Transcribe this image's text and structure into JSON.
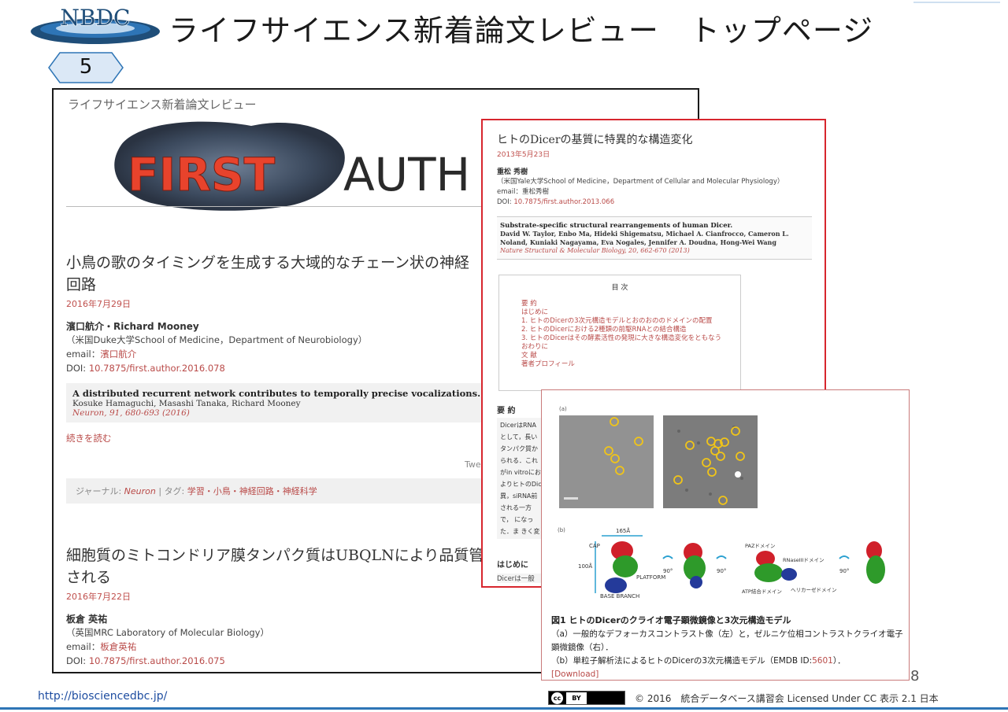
{
  "header": {
    "logo_text": "NBDC",
    "title": "ライフサイエンス新着論文レビュー　トップページ",
    "slide_number": "5"
  },
  "screenshot": {
    "site_name": "ライフサイエンス新着論文レビュー",
    "banner_text_red": "FIRST",
    "banner_text_dark": "AUTH",
    "articles": [
      {
        "title": "小鳥の歌のタイミングを生成する大域的なチェーン状の神経\n回路",
        "date": "2016年7月29日",
        "author": "濱口航介・Richard Mooney",
        "affiliation": "（米国Duke大学School of Medicine，Department of Neurobiology）",
        "email_label": "email：",
        "email_value": "濱口航介",
        "doi_label": "DOI: ",
        "doi_value": "10.7875/first.author.2016.078",
        "ref_title": "A distributed recurrent network contributes to temporally precise vocalizations.",
        "ref_authors": "Kosuke Hamaguchi, Masashi Tanaka, Richard Mooney",
        "ref_journal": "Neuron, 91, 680-693 (2016)",
        "read_more": "続きを読む"
      },
      {
        "title": "細胞質のミトコンドリア膜タンパク質はUBQLNにより品質管理\nされる",
        "date": "2016年7月22日",
        "author": "板倉 英祐",
        "affiliation": "（英国MRC Laboratory of Molecular Biology）",
        "email_label": "email：",
        "email_value": "板倉英祐",
        "doi_label": "DOI: ",
        "doi_value": "10.7875/first.author.2016.075"
      }
    ],
    "tweet_label": "Twe",
    "tag_bar": {
      "journal_label": "ジャーナル: ",
      "journal_value": "Neuron",
      "sep": " | ",
      "tag_label": "タグ: ",
      "tag_value": "学習・小鳥・神経回路・神経科学"
    }
  },
  "overlay_article": {
    "title": "ヒトのDicerの基質に特異的な構造変化",
    "date": "2013年5月23日",
    "author": "重松 秀樹",
    "affiliation": "（米国Yale大学School of Medicine，Department of Cellular and Molecular Physiology）",
    "email": "email：重松秀樹",
    "doi_label": "DOI: ",
    "doi_value": "10.7875/first.author.2013.066",
    "ref_title": "Substrate-specific structural rearrangements of human Dicer.",
    "ref_authors": "David W. Taylor, Enbo Ma, Hideki Shigematsu, Michael A. Cianfrocco, Cameron L. Noland, Kuniaki Nagayama, Eva Nogales, Jennifer A. Doudna, Hong-Wei Wang",
    "ref_journal": "Nature Structural & Molecular Biology, 20, 662-670 (2013)",
    "toc_heading": "目 次",
    "toc_items": [
      "要 約",
      "はじめに",
      "1. ヒトのDicerの3次元構造モデルとおのおののドメインの配置",
      "2. ヒトのDicerにおける2種類の前駆RNAとの結合構造",
      "3. ヒトのDicerはその酵素活性の発現に大きな構造変化をともなう",
      "おわりに",
      "文 献",
      "著者プロフィール"
    ],
    "abstract_heading": "要 約",
    "abstract_text": "DicerはRNA として，長い タンパク質か られる．これ がin vitroにお よりヒトのDic 異，siRNA前 される一方で， になった．ま きく変化させ の構造変化が",
    "intro_heading": "はじめに",
    "intro_text": "Dicerは一般"
  },
  "figure": {
    "label_a": "(a)",
    "label_b": "(b)",
    "dims": [
      "165Å",
      "100Å"
    ],
    "domain_labels": [
      "CAP",
      "PLATFORM",
      "BASE BRANCH",
      "PAZドメイン",
      "RNaseIIIドメイン",
      "ATP結合ドメイン",
      "ヘリカーゼドメイン"
    ],
    "rotations": [
      "90°",
      "90°",
      "90°"
    ],
    "caption_title": "図1 ヒトのDicerのクライオ電子顕微鏡像と3次元構造モデル",
    "caption_line1": "（a）一般的なデフォーカスコントラスト像（左）と，ゼルニケ位相コントラストクライオ電子顕微鏡像（右）．",
    "caption_line2_prefix": "（b）単粒子解析法によるヒトのDicerの3次元構造モデル（EMDB ID:",
    "caption_line2_link": "5601",
    "caption_line2_suffix": "）．",
    "download": "[Download]"
  },
  "footer": {
    "page_number": "8",
    "url": "http://biosciencedbc.jp/",
    "cc_label": "cc",
    "by_label": "BY",
    "copyright": "© 2016　統合データベース講習会 Licensed Under CC 表示 2.1 日本"
  },
  "colors": {
    "accent_red": "#d7262e",
    "link_red": "#b94a48",
    "footer_blue": "#2e75b6"
  }
}
